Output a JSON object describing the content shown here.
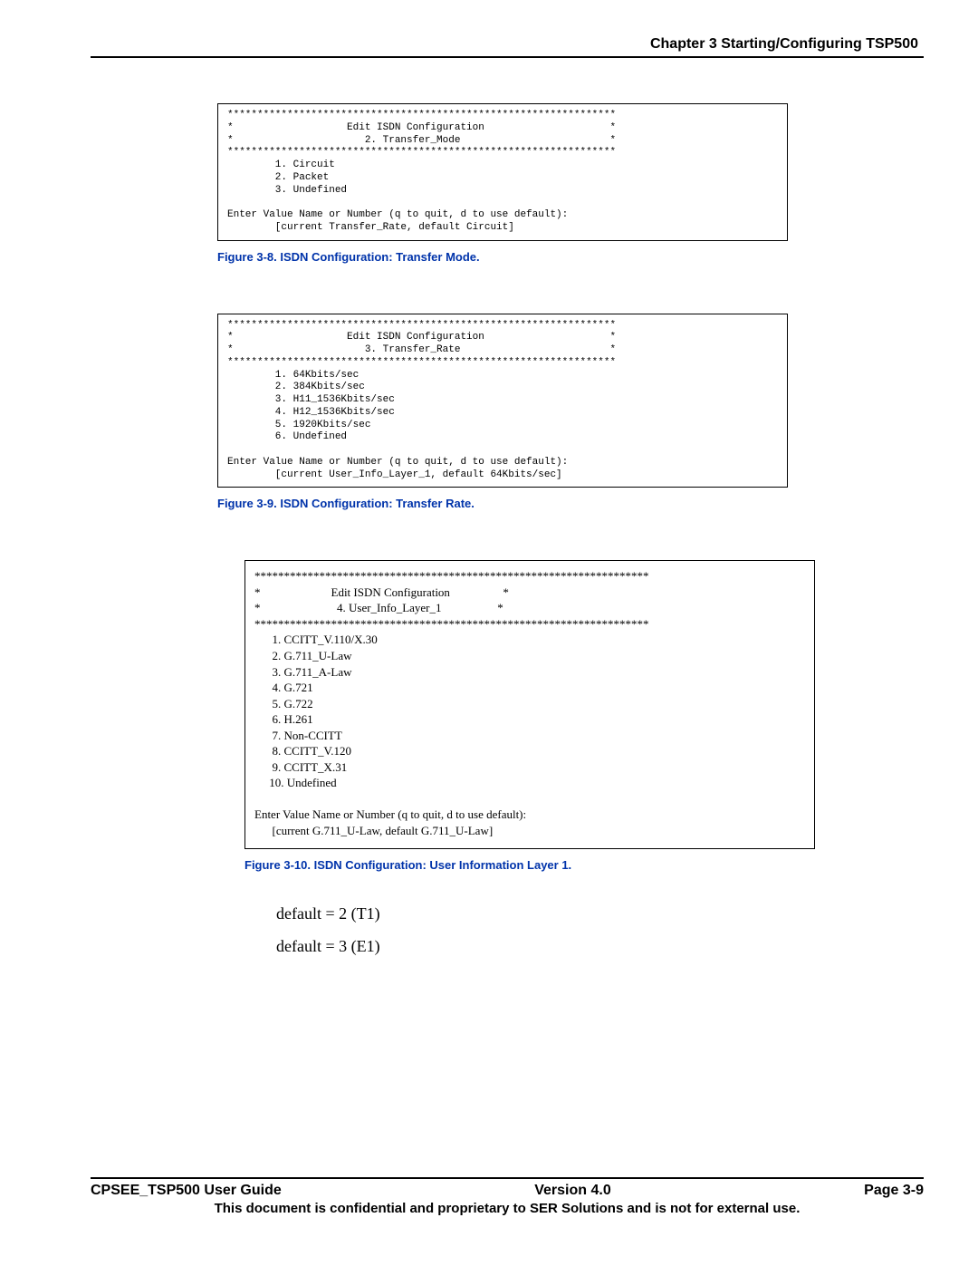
{
  "header": {
    "chapter_title": "Chapter 3 Starting/Configuring TSP500"
  },
  "figure1": {
    "console": "*****************************************************************\n*                   Edit ISDN Configuration                     *\n*                      2. Transfer_Mode                         *\n*****************************************************************\n        1. Circuit\n        2. Packet\n        3. Undefined\n\nEnter Value Name or Number (q to quit, d to use default):\n        [current Transfer_Rate, default Circuit]",
    "caption": "Figure 3-8. ISDN Configuration: Transfer Mode."
  },
  "figure2": {
    "console": "*****************************************************************\n*                   Edit ISDN Configuration                     *\n*                      3. Transfer_Rate                         *\n*****************************************************************\n        1. 64Kbits/sec\n        2. 384Kbits/sec\n        3. H11_1536Kbits/sec\n        4. H12_1536Kbits/sec\n        5. 1920Kbits/sec\n        6. Undefined\n\nEnter Value Name or Number (q to quit, d to use default):\n        [current User_Info_Layer_1, default 64Kbits/sec]",
    "caption": "Figure 3-9. ISDN Configuration: Transfer Rate."
  },
  "figure3": {
    "console": "*******************************************************************\n*                        Edit ISDN Configuration                  *\n*                          4. User_Info_Layer_1                   *\n*******************************************************************\n      1. CCITT_V.110/X.30\n      2. G.711_U-Law\n      3. G.711_A-Law\n      4. G.721\n      5. G.722\n      6. H.261\n      7. Non-CCITT\n      8. CCITT_V.120\n      9. CCITT_X.31\n     10. Undefined\n\nEnter Value Name or Number (q to quit, d to use default):\n      [current G.711_U-Law, default G.711_U-Law]",
    "caption": "Figure 3-10. ISDN Configuration: User Information Layer 1."
  },
  "defaults": {
    "line1": "default = 2 (T1)",
    "line2": "default = 3 (E1)"
  },
  "footer": {
    "left": "CPSEE_TSP500 User Guide",
    "center": "Version 4.0",
    "right": "Page 3-9",
    "confidential": "This document is confidential and proprietary to SER Solutions and is not for external use."
  }
}
